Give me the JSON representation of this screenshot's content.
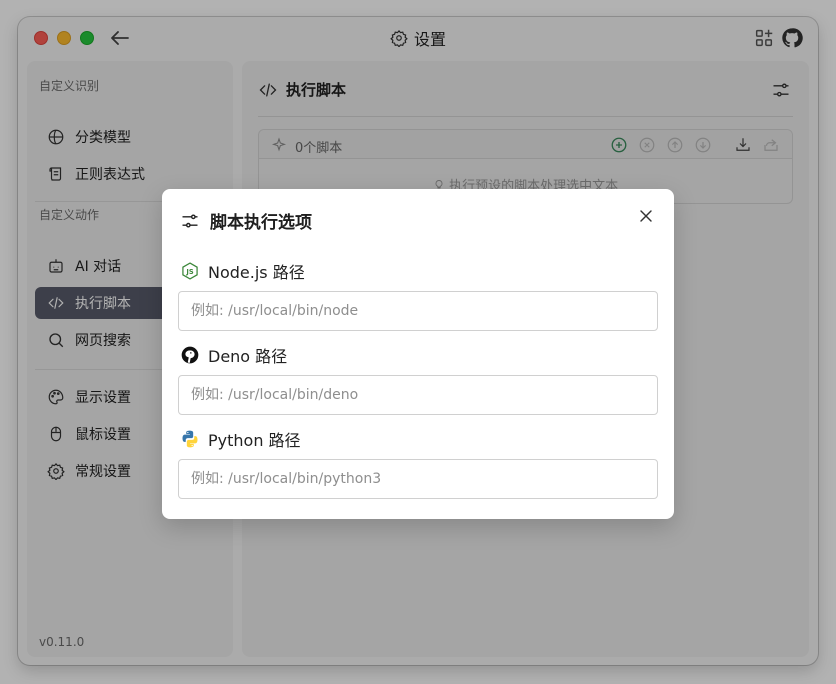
{
  "window": {
    "title": "设置",
    "title_icon": "gear-icon",
    "back_icon": "arrow-left-icon",
    "right_icons": [
      "grid-add-icon",
      "github-icon"
    ]
  },
  "sidebar": {
    "group1_title": "自定义识别",
    "group2_title": "自定义动作",
    "items": [
      {
        "label": "分类模型",
        "icon": "globe-icon"
      },
      {
        "label": "正则表达式",
        "icon": "scroll-icon"
      },
      {
        "label": "AI 对话",
        "icon": "bot-icon"
      },
      {
        "label": "执行脚本",
        "icon": "code-icon"
      },
      {
        "label": "网页搜索",
        "icon": "search-icon"
      },
      {
        "label": "显示设置",
        "icon": "palette-icon"
      },
      {
        "label": "鼠标设置",
        "icon": "mouse-icon"
      },
      {
        "label": "常规设置",
        "icon": "gear-icon"
      }
    ],
    "active_index": 3,
    "version": "v0.11.0"
  },
  "content": {
    "title": "执行脚本",
    "title_icon": "code-icon",
    "settings_icon": "sliders-icon",
    "script_count": "0个脚本",
    "toolbar_icons": [
      "sparkle-icon",
      "add-circle-icon",
      "remove-circle-icon",
      "move-up-icon",
      "move-down-icon",
      "import-icon",
      "export-icon"
    ],
    "empty_hint": "执行预设的脚本处理选中文本"
  },
  "dialog": {
    "title": "脚本执行选项",
    "title_icon": "sliders-icon",
    "close_icon": "close-icon",
    "fields": [
      {
        "label": "Node.js 路径",
        "icon": "nodejs-icon",
        "value": "",
        "placeholder": "例如: /usr/local/bin/node"
      },
      {
        "label": "Deno 路径",
        "icon": "deno-icon",
        "value": "",
        "placeholder": "例如: /usr/local/bin/deno"
      },
      {
        "label": "Python 路径",
        "icon": "python-icon",
        "value": "",
        "placeholder": "例如: /usr/local/bin/python3"
      }
    ]
  },
  "colors": {
    "sidebar_active": "#585b6a",
    "accent_green": "#3a8a5c",
    "overlay": "rgba(0,0,0,0.30)"
  }
}
